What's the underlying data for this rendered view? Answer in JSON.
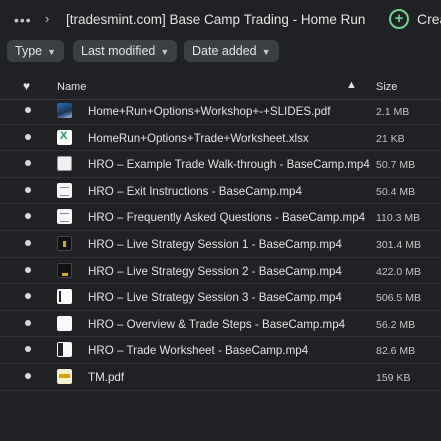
{
  "topbar": {
    "more_label": "•••",
    "chevron": "›",
    "breadcrumb": "[tradesmint.com] Base Camp Trading - Home Run Optio...",
    "create_label": "Crea",
    "create_icon": "plus-circle-icon",
    "create_color": "#6dd58c"
  },
  "filters": {
    "type": "Type",
    "modified": "Last modified",
    "added": "Date added",
    "caret": "▼"
  },
  "columns": {
    "favorite_icon": "♥",
    "name": "Name",
    "sort_icon": "▲",
    "size": "Size"
  },
  "files": [
    {
      "name": "Home+Run+Options+Workshop+-+SLIDES.pdf",
      "size": "2.1 MB"
    },
    {
      "name": "HomeRun+Options+Trade+Worksheet.xlsx",
      "size": "21 KB"
    },
    {
      "name": "HRO – Example Trade Walk-through - BaseCamp.mp4",
      "size": "50.7 MB"
    },
    {
      "name": "HRO – Exit Instructions - BaseCamp.mp4",
      "size": "50.4 MB"
    },
    {
      "name": "HRO – Frequently Asked Questions - BaseCamp.mp4",
      "size": "110.3 MB"
    },
    {
      "name": "HRO – Live Strategy Session 1 - BaseCamp.mp4",
      "size": "301.4 MB"
    },
    {
      "name": "HRO – Live Strategy Session 2 - BaseCamp.mp4",
      "size": "422.0 MB"
    },
    {
      "name": "HRO – Live Strategy Session 3 - BaseCamp.mp4",
      "size": "506.5 MB"
    },
    {
      "name": "HRO – Overview & Trade Steps - BaseCamp.mp4",
      "size": "56.2 MB"
    },
    {
      "name": "HRO – Trade Worksheet - BaseCamp.mp4",
      "size": "82.6 MB"
    },
    {
      "name": "TM.pdf",
      "size": "159 KB"
    }
  ]
}
